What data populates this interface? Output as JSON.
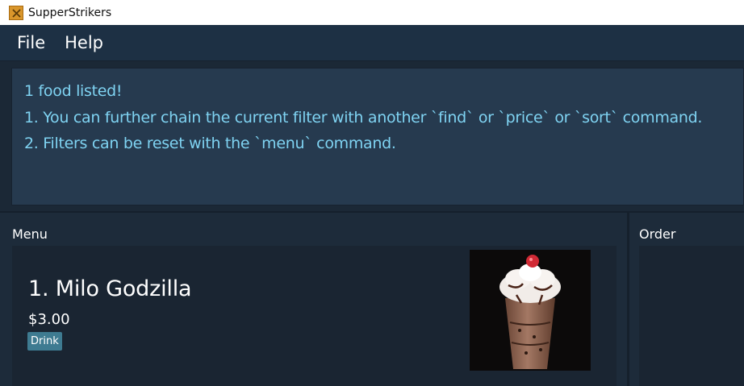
{
  "window": {
    "title": "SupperStrikers"
  },
  "menubar": {
    "items": [
      "File",
      "Help"
    ]
  },
  "result": {
    "lines": [
      "1 food listed!",
      "1. You can further chain the current filter with another `find` or `price` or `sort` command.",
      "2. Filters can be reset with the `menu` command."
    ]
  },
  "menu_panel": {
    "title": "Menu",
    "items": [
      {
        "name": "1.  Milo Godzilla",
        "price": "$3.00",
        "tag": "Drink",
        "image_icon": "milo-drink-photo"
      }
    ]
  },
  "order_panel": {
    "title": "Order"
  },
  "colors": {
    "result_text": "#7fd3f2",
    "tag_background": "#3e7b91",
    "panel_background": "#1d2b3a"
  }
}
